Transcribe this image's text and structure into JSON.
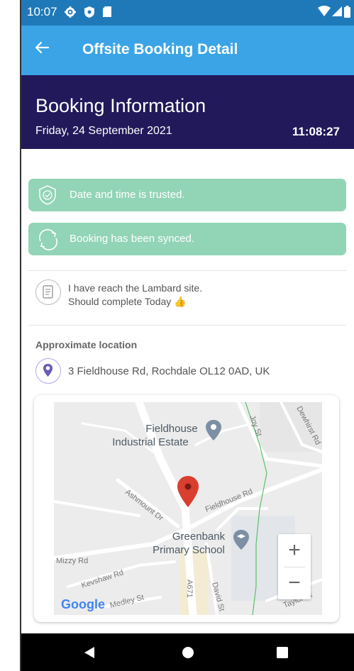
{
  "status_bar": {
    "time": "10:07",
    "left_icons": [
      "settings-icon",
      "shield-icon",
      "sd-card-icon"
    ],
    "right_icons": [
      "wifi-icon",
      "signal-icon",
      "battery-icon"
    ]
  },
  "app_bar": {
    "title": "Offsite Booking Detail",
    "back_icon": "arrow-left-icon"
  },
  "header": {
    "title": "Booking Information",
    "date": "Friday, 24 September 2021",
    "time": "11:08:27"
  },
  "banners": [
    {
      "icon": "shield-check-icon",
      "text": "Date and time is trusted."
    },
    {
      "icon": "sync-icon",
      "text": "Booking has been synced."
    }
  ],
  "note": {
    "icon": "note-icon",
    "line1": "I have reach the Lambard site.",
    "line2": "Should complete Today",
    "emoji": "👍"
  },
  "location": {
    "label": "Approximate location",
    "icon": "map-pin-icon",
    "address": "3 Fieldhouse Rd, Rochdale OL12 0AD, UK"
  },
  "map": {
    "labels": {
      "poi1_line1": "Fieldhouse",
      "poi1_line2": "Industrial Estate",
      "poi2_line1": "Greenbank",
      "poi2_line2": "Primary School",
      "road_fieldhouse": "Fieldhouse Rd",
      "road_ashmount": "Ashmount Dr",
      "road_mizzy": "Mizzy Rd",
      "road_kevshaw": "Kevshaw Rd",
      "road_medley": "Medley St",
      "road_a671": "A671",
      "road_david": "David St",
      "road_joy": "Joy St",
      "road_dewhirst": "Dewhirst Rd",
      "road_taylor": "Taylor St",
      "google": "Google"
    },
    "zoom_in": "+",
    "zoom_out": "−"
  },
  "nav_bar": [
    "back-nav-icon",
    "home-nav-icon",
    "recents-nav-icon"
  ],
  "colors": {
    "status_bar": "#1f79b9",
    "app_bar": "#3aa4e6",
    "header": "#21195a",
    "banner": "#92d4b6",
    "accent_purple": "#6a5bb5",
    "map_marker": "#d93f2f"
  }
}
